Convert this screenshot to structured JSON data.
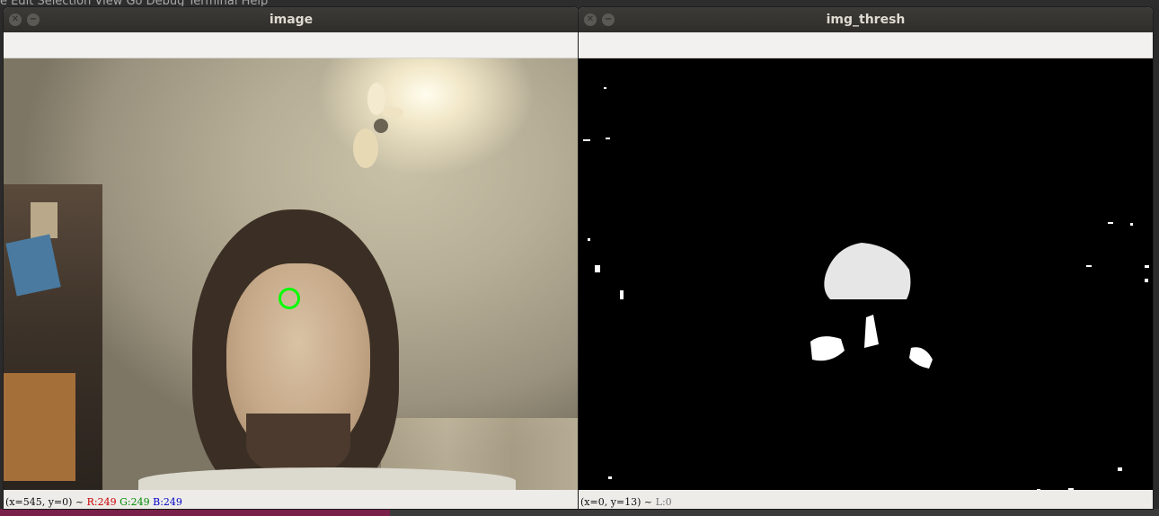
{
  "background": {
    "menu": "e   Edit   Selection   View   Go   Debug   Terminal   Help"
  },
  "windows": [
    {
      "title": "image",
      "status": {
        "coords": "(x=545, y=0) ~",
        "r": "R:249",
        "g": "G:249",
        "b": "B:249"
      }
    },
    {
      "title": "img_thresh",
      "status": {
        "coords": "(x=0, y=13) ~",
        "l": "L:0"
      }
    }
  ],
  "colors": {
    "marker": "#00ff00",
    "titlebar": "#3c3b37",
    "status_r": "#c80000",
    "status_g": "#008a00",
    "status_b": "#0000c8"
  },
  "icons": {
    "close": "close-icon",
    "minimize": "minimize-icon"
  }
}
